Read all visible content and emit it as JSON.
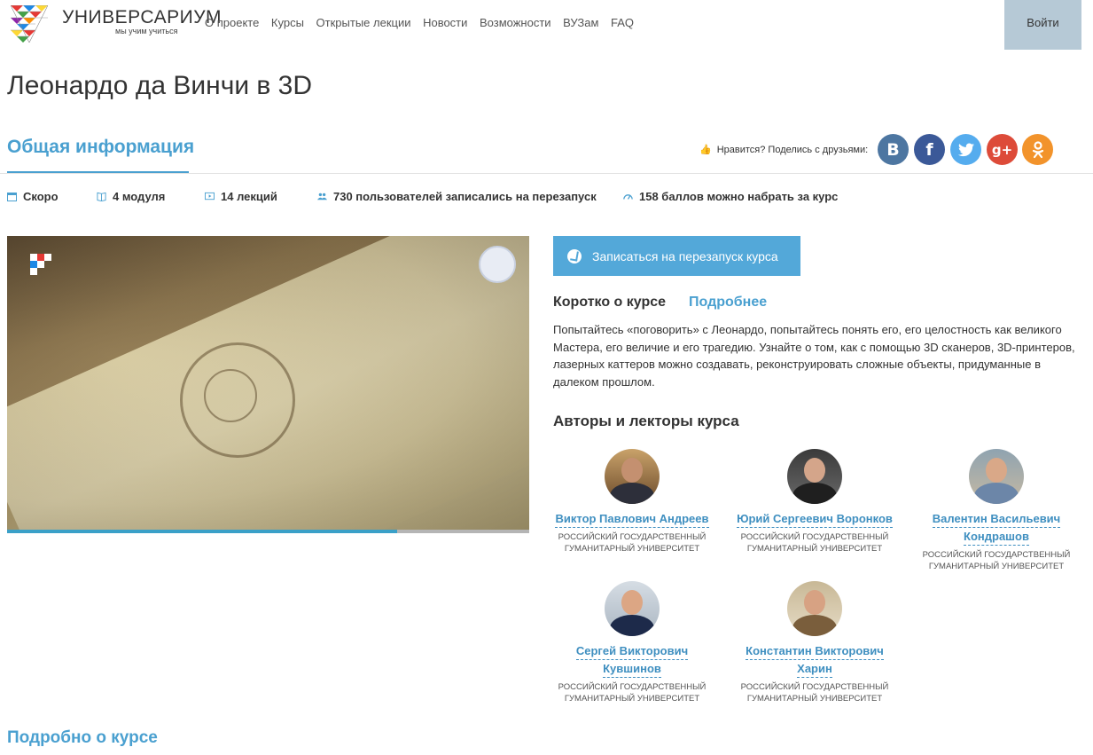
{
  "header": {
    "logo_name": "УНИВЕРСАРИУМ",
    "logo_tagline": "мы учим учиться",
    "nav": [
      "О проекте",
      "Курсы",
      "Открытые лекции",
      "Новости",
      "Возможности",
      "ВУЗам",
      "FAQ"
    ],
    "login_label": "Войти"
  },
  "page": {
    "title": "Леонардо да Винчи в 3D"
  },
  "info": {
    "tab_label": "Общая информация",
    "share_label": "Нравится? Поделись с друзьями:",
    "social": [
      {
        "name": "vk-icon",
        "glyph": "B",
        "color": "#4d76a1"
      },
      {
        "name": "facebook-icon",
        "glyph": "f",
        "color": "#3b5998"
      },
      {
        "name": "twitter-icon",
        "glyph": "🐦",
        "color": "#55acee"
      },
      {
        "name": "google-plus-icon",
        "glyph": "g+",
        "color": "#dd4b39"
      },
      {
        "name": "odnoklassniki-icon",
        "glyph": "ok",
        "color": "#f2932b"
      }
    ],
    "stats": {
      "start": "Скоро",
      "modules": "4 модуля",
      "lectures": "14 лекций",
      "users": "730 пользователей записались на перезапуск",
      "points": "158 баллов можно набрать за курс"
    }
  },
  "video": {
    "progress": 0.747
  },
  "course": {
    "enroll_label": "Записаться на перезапуск курса",
    "tab_short": "Коротко о курсе",
    "tab_detail": "Подробнее",
    "description": "Попытайтесь «поговорить» с Леонардо, попытайтесь понять его, его целостность как великого Мастера, его величие и его трагедию. Узнайте о том, как с помощью 3D сканеров, 3D-принтеров, лазерных каттеров можно создавать, реконструировать сложные объекты, придуманные в далеком прошлом.",
    "authors_title": "Авторы и лекторы курса",
    "authors": [
      {
        "name_line1": "Виктор Павлович Андреев",
        "name_line2": "",
        "org": "РОССИЙСКИЙ ГОСУДАРСТВЕННЫЙ ГУМАНИТАРНЫЙ УНИВЕРСИТЕТ"
      },
      {
        "name_line1": "Юрий Сергеевич Воронков",
        "name_line2": "",
        "org": "РОССИЙСКИЙ ГОСУДАРСТВЕННЫЙ ГУМАНИТАРНЫЙ УНИВЕРСИТЕТ"
      },
      {
        "name_line1": "Валентин Васильевич",
        "name_line2": "Кондрашов",
        "org": "РОССИЙСКИЙ ГОСУДАРСТВЕННЫЙ ГУМАНИТАРНЫЙ УНИВЕРСИТЕТ"
      },
      {
        "name_line1": "Сергей Викторович",
        "name_line2": "Кувшинов",
        "org": "РОССИЙСКИЙ ГОСУДАРСТВЕННЫЙ ГУМАНИТАРНЫЙ УНИВЕРСИТЕТ"
      },
      {
        "name_line1": "Константин Викторович",
        "name_line2": "Харин",
        "org": "РОССИЙСКИЙ ГОСУДАРСТВЕННЫЙ ГУМАНИТАРНЫЙ УНИВЕРСИТЕТ"
      }
    ],
    "more_title": "Подробно о курсе"
  }
}
